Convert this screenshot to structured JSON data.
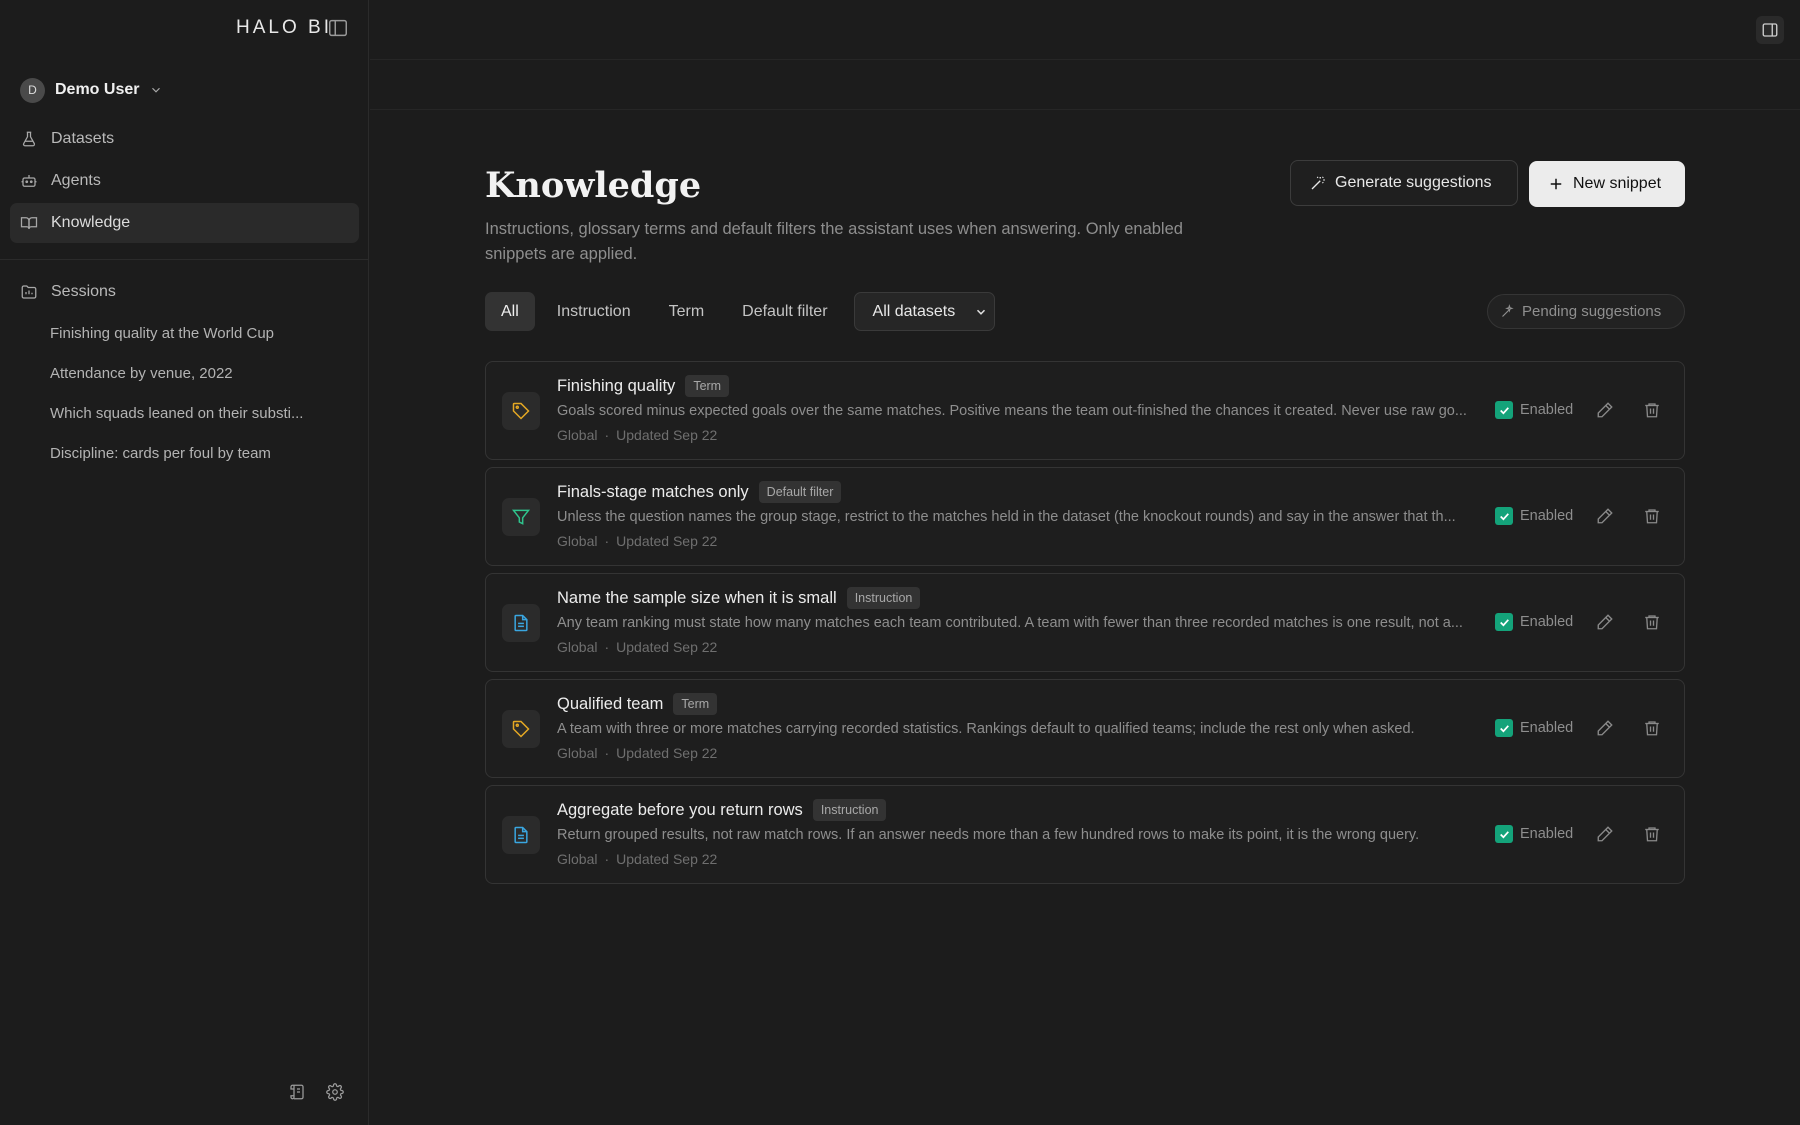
{
  "sidebar": {
    "brand": "HALO BI",
    "user": {
      "initial": "D",
      "name": "Demo User"
    },
    "nav": [
      {
        "label": "Datasets",
        "icon": "flask-icon"
      },
      {
        "label": "Agents",
        "icon": "robot-icon"
      },
      {
        "label": "Knowledge",
        "icon": "book-icon",
        "active": true
      }
    ],
    "sessions_label": "Sessions",
    "sessions": [
      "Finishing quality at the World Cup",
      "Attendance by venue, 2022",
      "Which squads leaned on their substi...",
      "Discipline: cards per foul by team"
    ]
  },
  "page": {
    "title": "Knowledge",
    "description": "Instructions, glossary terms and default filters the assistant uses when answering. Only enabled snippets are applied.",
    "generate_label": "Generate suggestions",
    "new_label": "New snippet",
    "filters": [
      "All",
      "Instruction",
      "Term",
      "Default filter"
    ],
    "active_filter": "All",
    "dataset_select": "All datasets",
    "pending_label": "Pending suggestions"
  },
  "colors": {
    "term": "#e5a823",
    "filter": "#2fc48d",
    "instruction": "#3aa6e0",
    "enabled_check": "#14a37a"
  },
  "snippets": [
    {
      "title": "Finishing quality",
      "type": "Term",
      "icon": "tag-icon",
      "description": "Goals scored minus expected goals over the same matches. Positive means the team out-finished the chances it created. Never use raw go...",
      "scope": "Global",
      "updated": "Updated Sep 22",
      "enabled_label": "Enabled"
    },
    {
      "title": "Finals-stage matches only",
      "type": "Default filter",
      "icon": "filter-icon",
      "description": "Unless the question names the group stage, restrict to the matches held in the dataset (the knockout rounds) and say in the answer that th...",
      "scope": "Global",
      "updated": "Updated Sep 22",
      "enabled_label": "Enabled"
    },
    {
      "title": "Name the sample size when it is small",
      "type": "Instruction",
      "icon": "document-icon",
      "description": "Any team ranking must state how many matches each team contributed. A team with fewer than three recorded matches is one result, not a...",
      "scope": "Global",
      "updated": "Updated Sep 22",
      "enabled_label": "Enabled"
    },
    {
      "title": "Qualified team",
      "type": "Term",
      "icon": "tag-icon",
      "description": "A team with three or more matches carrying recorded statistics. Rankings default to qualified teams; include the rest only when asked.",
      "scope": "Global",
      "updated": "Updated Sep 22",
      "enabled_label": "Enabled"
    },
    {
      "title": "Aggregate before you return rows",
      "type": "Instruction",
      "icon": "document-icon",
      "description": "Return grouped results, not raw match rows. If an answer needs more than a few hundred rows to make its point, it is the wrong query.",
      "scope": "Global",
      "updated": "Updated Sep 22",
      "enabled_label": "Enabled"
    }
  ]
}
